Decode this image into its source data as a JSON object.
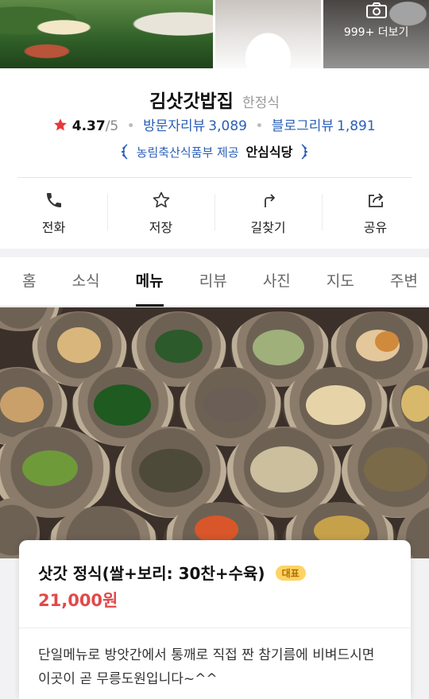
{
  "photos": {
    "more_label": "999+ 더보기",
    "more_icon": "camera-icon"
  },
  "place": {
    "name": "김삿갓밥집",
    "category": "한정식",
    "rating": "4.37",
    "rating_max": "/5",
    "visitor_review_label": "방문자리뷰",
    "visitor_review_count": "3,089",
    "blog_review_label": "블로그리뷰",
    "blog_review_count": "1,891",
    "certification_provider": "농림축산식품부 제공",
    "certification_name": "안심식당",
    "star_color": "#e5393b",
    "link_color": "#2a5fb8"
  },
  "actions": [
    {
      "label": "전화",
      "icon": "phone-icon"
    },
    {
      "label": "저장",
      "icon": "star-outline-icon"
    },
    {
      "label": "길찾기",
      "icon": "directions-icon"
    },
    {
      "label": "공유",
      "icon": "share-icon"
    }
  ],
  "tabs": [
    {
      "label": "홈",
      "active": false
    },
    {
      "label": "소식",
      "active": false
    },
    {
      "label": "메뉴",
      "active": true
    },
    {
      "label": "리뷰",
      "active": false
    },
    {
      "label": "사진",
      "active": false
    },
    {
      "label": "지도",
      "active": false
    },
    {
      "label": "주변",
      "active": false
    }
  ],
  "menu_item": {
    "name": "삿갓 정식(쌀+보리: 30찬+수육)",
    "badge": "대표",
    "price": "21,000원",
    "description": "단일메뉴로 방앗간에서 통깨로 직접 짠 참기름에 비벼드시면 이곳이 곧 무릉도원입니다~^^",
    "price_color": "#e2494b",
    "badge_color": "#ffd363"
  }
}
